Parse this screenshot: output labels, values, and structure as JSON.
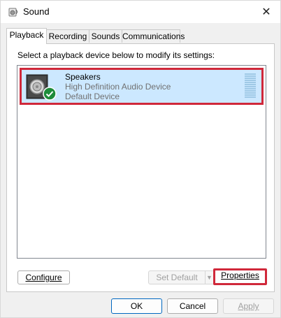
{
  "window": {
    "title": "Sound",
    "close_glyph": "✕"
  },
  "tabs": [
    {
      "label": "Playback",
      "active": true
    },
    {
      "label": "Recording",
      "active": false
    },
    {
      "label": "Sounds",
      "active": false
    },
    {
      "label": "Communications",
      "active": false
    }
  ],
  "panel": {
    "instructions": "Select a playback device below to modify its settings:",
    "devices": [
      {
        "name": "Speakers",
        "description": "High Definition Audio Device",
        "status": "Default Device",
        "icon": "speaker-icon",
        "status_icon": "checkmark-icon",
        "selected": true
      }
    ]
  },
  "buttons": {
    "configure": "Configure",
    "set_default": "Set Default",
    "properties": "Properties",
    "ok": "OK",
    "cancel": "Cancel",
    "apply": "Apply"
  },
  "colors": {
    "selection": "#cce8ff",
    "highlight_border": "#d0283a",
    "default_check": "#1e8c3a"
  }
}
